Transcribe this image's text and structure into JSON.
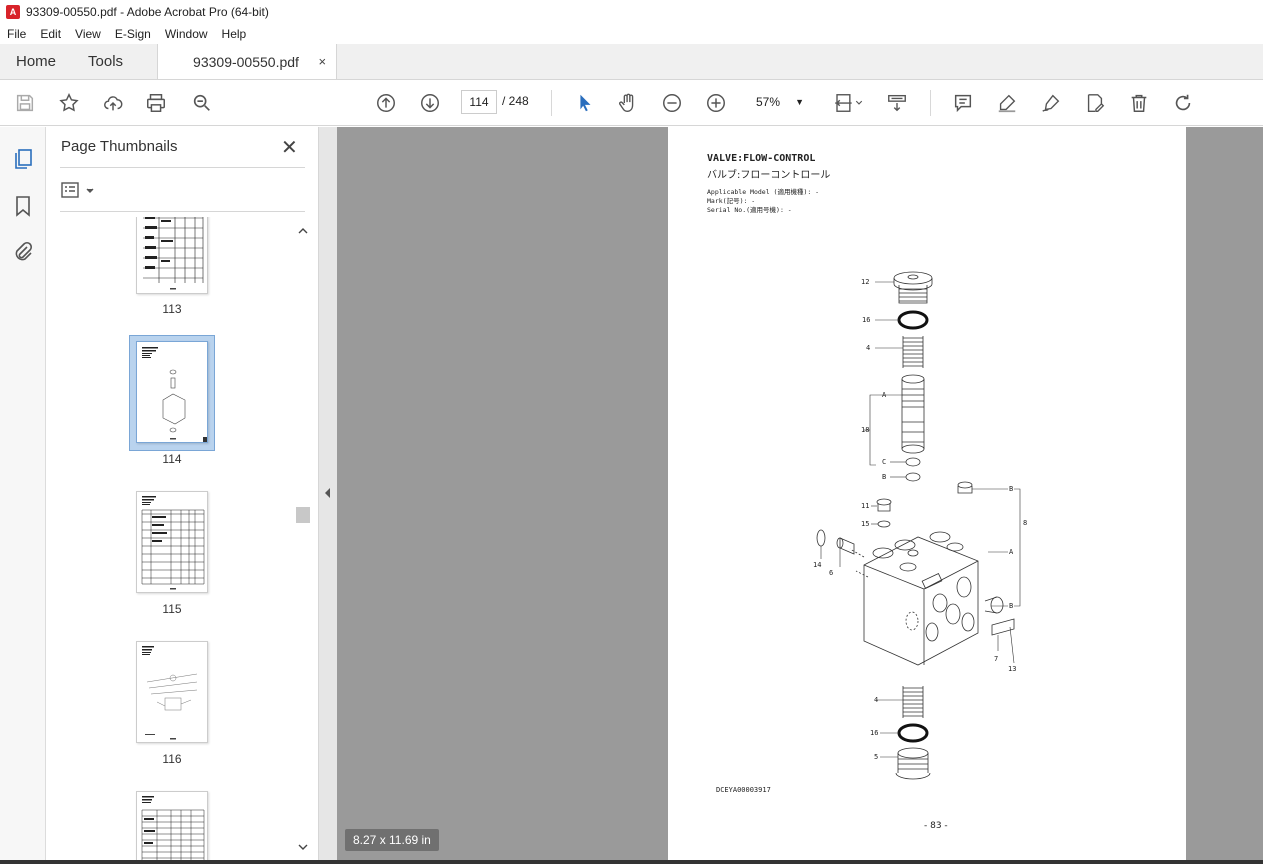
{
  "window": {
    "title": "93309-00550.pdf - Adobe Acrobat Pro (64-bit)"
  },
  "menu": [
    "File",
    "Edit",
    "View",
    "E-Sign",
    "Window",
    "Help"
  ],
  "tabs": {
    "home": "Home",
    "tools": "Tools",
    "document": "93309-00550.pdf",
    "close": "×"
  },
  "toolbar": {
    "current_page": "114",
    "page_total": "/  248",
    "zoom": "57%"
  },
  "panel": {
    "title": "Page Thumbnails",
    "close": "✕",
    "thumbnails": [
      {
        "label": "113"
      },
      {
        "label": "114",
        "selected": true
      },
      {
        "label": "115"
      },
      {
        "label": "116"
      }
    ]
  },
  "document_page": {
    "title_en": "VALVE:FLOW-CONTROL",
    "title_jp": "バルブ:フローコントロール",
    "applicable_model": "Applicable Model (適用機種): -",
    "mark": "Mark(記号): -",
    "serial_no": "Serial No.(適用号機): -",
    "drawing_code": "DCEYA00003917",
    "page_number": "- 83 -",
    "callouts": [
      "12",
      "16",
      "4",
      "A",
      "18",
      "C",
      "B",
      "11",
      "15",
      "B",
      "8",
      "A",
      "14",
      "6",
      "B",
      "7",
      "13",
      "4",
      "16",
      "5"
    ]
  },
  "page_size": "8.27 x 11.69 in"
}
